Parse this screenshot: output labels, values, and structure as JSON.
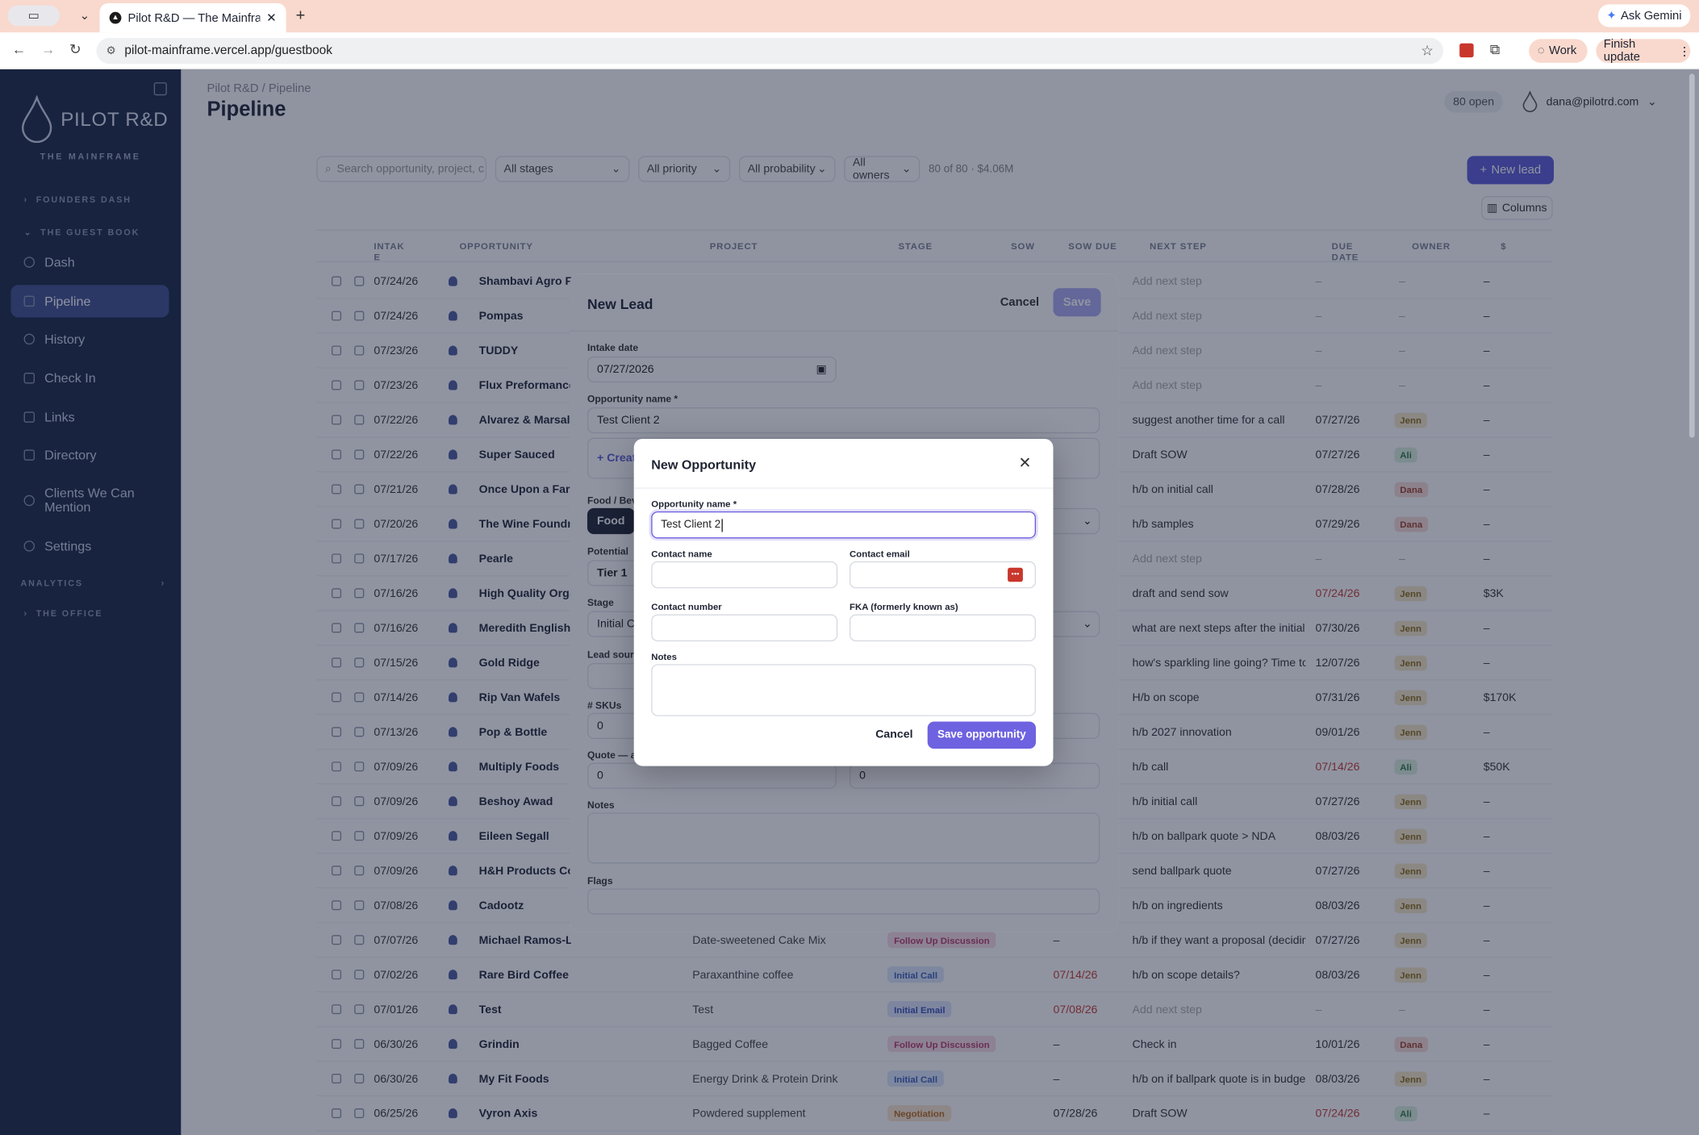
{
  "browser": {
    "tab_title": "Pilot R&D — The Mainframe",
    "url": "pilot-mainframe.vercel.app/guestbook",
    "ask_gemini": "Ask Gemini",
    "profile": "Work",
    "finish_update": "Finish update"
  },
  "sidebar": {
    "logo": "PILOT R&D",
    "tagline": "THE MAINFRAME",
    "founders_dash": "FOUNDERS DASH",
    "guest_book": "THE GUEST BOOK",
    "items": [
      {
        "label": "Dash"
      },
      {
        "label": "Pipeline"
      },
      {
        "label": "History"
      },
      {
        "label": "Check In"
      },
      {
        "label": "Links"
      },
      {
        "label": "Directory"
      },
      {
        "label": "Clients We Can Mention"
      },
      {
        "label": "Settings"
      }
    ],
    "analytics": "ANALYTICS",
    "office": "THE OFFICE"
  },
  "header": {
    "breadcrumb": "Pilot R&D / Pipeline",
    "title": "Pipeline",
    "open_count": "80 open",
    "user": "dana@pilotrd.com"
  },
  "filters": {
    "search_placeholder": "Search opportunity, project, c",
    "stages": "All stages",
    "priority": "All priority",
    "probability": "All probability",
    "owners": "All owners",
    "summary": "80 of 80 · $4.06M",
    "new_lead": "New lead",
    "columns": "Columns"
  },
  "table": {
    "headers": {
      "intake": "INTAK E",
      "opportunity": "OPPORTUNITY",
      "project": "PROJECT",
      "stage": "STAGE",
      "sow": "SOW",
      "sow_due": "SOW DUE",
      "next_step": "NEXT STEP",
      "due_date": "DUE DATE",
      "owner": "OWNER",
      "value": "$"
    },
    "rows": [
      {
        "date": "07/24/26",
        "name": "Shambavi Agro Fa",
        "project": "",
        "stage": "",
        "sow_due": "",
        "next": "Add next step",
        "due": "–",
        "owner": "",
        "val": "–"
      },
      {
        "date": "07/24/26",
        "name": "Pompas",
        "project": "",
        "stage": "",
        "sow_due": "",
        "next": "Add next step",
        "due": "–",
        "owner": "",
        "val": "–"
      },
      {
        "date": "07/23/26",
        "name": "TUDDY",
        "project": "",
        "stage": "",
        "sow_due": "",
        "next": "Add next step",
        "due": "–",
        "owner": "",
        "val": "–"
      },
      {
        "date": "07/23/26",
        "name": "Flux Preformance",
        "project": "",
        "stage": "",
        "sow_due": "",
        "next": "Add next step",
        "due": "–",
        "owner": "",
        "val": "–"
      },
      {
        "date": "07/22/26",
        "name": "Alvarez & Marsal",
        "project": "",
        "stage": "",
        "sow_due": "",
        "next": "suggest another time for a call",
        "due": "07/27/26",
        "owner": "Jenn",
        "val": "–"
      },
      {
        "date": "07/22/26",
        "name": "Super Sauced",
        "project": "",
        "stage": "",
        "sow_due": "",
        "next": "Draft SOW",
        "due": "07/27/26",
        "owner": "Ali",
        "val": "–"
      },
      {
        "date": "07/21/26",
        "name": "Once Upon a Farm",
        "project": "",
        "stage": "",
        "sow_due": "",
        "next": "h/b on initial call",
        "due": "07/28/26",
        "owner": "Dana",
        "val": "–"
      },
      {
        "date": "07/20/26",
        "name": "The Wine Foundry",
        "project": "",
        "stage": "",
        "sow_due": "",
        "next": "h/b samples",
        "due": "07/29/26",
        "owner": "Dana",
        "val": "–"
      },
      {
        "date": "07/17/26",
        "name": "Pearle",
        "project": "",
        "stage": "",
        "sow_due": "",
        "next": "Add next step",
        "due": "–",
        "owner": "",
        "val": "–"
      },
      {
        "date": "07/16/26",
        "name": "High Quality Orga",
        "project": "",
        "stage": "",
        "sow_due": "",
        "next": "draft and send sow",
        "due": "07/24/26",
        "owner": "Jenn",
        "val": "$3K"
      },
      {
        "date": "07/16/26",
        "name": "Meredith English",
        "project": "",
        "stage": "",
        "sow_due": "",
        "next": "what are next steps after the initial c",
        "due": "07/30/26",
        "owner": "Jenn",
        "val": "–"
      },
      {
        "date": "07/15/26",
        "name": "Gold Ridge",
        "project": "",
        "stage": "",
        "sow_due": "",
        "next": "how's sparkling line going? Time to g",
        "due": "12/07/26",
        "owner": "Jenn",
        "val": "–"
      },
      {
        "date": "07/14/26",
        "name": "Rip Van Wafels",
        "project": "",
        "stage": "",
        "sow_due": "",
        "next": "H/b on scope",
        "due": "07/31/26",
        "owner": "Jenn",
        "val": "$170K"
      },
      {
        "date": "07/13/26",
        "name": "Pop & Bottle",
        "project": "",
        "stage": "",
        "sow_due": "",
        "next": "h/b 2027 innovation",
        "due": "09/01/26",
        "owner": "Jenn",
        "val": "–"
      },
      {
        "date": "07/09/26",
        "name": "Multiply Foods",
        "project": "",
        "stage": "",
        "sow_due": "",
        "next": "h/b call",
        "due": "07/14/26",
        "owner": "Ali",
        "val": "$50K"
      },
      {
        "date": "07/09/26",
        "name": "Beshoy Awad",
        "project": "",
        "stage": "",
        "sow_due": "",
        "next": "h/b initial call",
        "due": "07/27/26",
        "owner": "Jenn",
        "val": "–"
      },
      {
        "date": "07/09/26",
        "name": "Eileen Segall",
        "project": "",
        "stage": "",
        "sow_due": "",
        "next": "h/b on ballpark quote > NDA",
        "due": "08/03/26",
        "owner": "Jenn",
        "val": "–"
      },
      {
        "date": "07/09/26",
        "name": "H&H Products Co",
        "project": "",
        "stage": "",
        "sow_due": "",
        "next": "send ballpark quote",
        "due": "07/27/26",
        "owner": "Jenn",
        "val": "–"
      },
      {
        "date": "07/08/26",
        "name": "Cadootz",
        "project": "",
        "stage": "",
        "sow_due": "",
        "next": "h/b on ingredients",
        "due": "08/03/26",
        "owner": "Jenn",
        "val": "–"
      },
      {
        "date": "07/07/26",
        "name": "Michael Ramos-Lynch",
        "project": "Date-sweetened Cake Mix",
        "stage": "Follow Up Discussion",
        "sow_due": "–",
        "next": "h/b if they want a proposal (deciding",
        "due": "07/27/26",
        "owner": "Jenn",
        "val": "–"
      },
      {
        "date": "07/02/26",
        "name": "Rare Bird Coffee",
        "project": "Paraxanthine coffee",
        "stage": "Initial Call",
        "sow_due": "07/14/26",
        "next": "h/b on scope details?",
        "due": "08/03/26",
        "owner": "Jenn",
        "val": "–"
      },
      {
        "date": "07/01/26",
        "name": "Test",
        "project": "Test",
        "stage": "Initial Email",
        "sow_due": "07/08/26",
        "next": "Add next step",
        "due": "–",
        "owner": "",
        "val": "–"
      },
      {
        "date": "06/30/26",
        "name": "Grindin",
        "project": "Bagged Coffee",
        "stage": "Follow Up Discussion",
        "sow_due": "–",
        "next": "Check in",
        "due": "10/01/26",
        "owner": "Dana",
        "val": "–"
      },
      {
        "date": "06/30/26",
        "name": "My Fit Foods",
        "project": "Energy Drink & Protein Drink",
        "stage": "Initial Call",
        "sow_due": "–",
        "next": "h/b on if ballpark quote is in budget a",
        "due": "08/03/26",
        "owner": "Jenn",
        "val": "–"
      },
      {
        "date": "06/25/26",
        "name": "Vyron Axis",
        "project": "Powdered supplement",
        "stage": "Negotiation",
        "sow_due": "07/28/26",
        "next": "Draft SOW",
        "due": "07/24/26",
        "owner": "Ali",
        "val": "–"
      }
    ]
  },
  "lead_modal": {
    "title": "New Lead",
    "cancel": "Cancel",
    "save": "Save",
    "intake_label": "Intake date",
    "intake_value": "07/27/2026",
    "opp_label": "Opportunity name *",
    "opp_value": "Test Client 2",
    "create": "+ Create",
    "food_label": "Food / Bev",
    "food_value": "Food",
    "potential_label": "Potential",
    "potential_value": "Tier 1",
    "stage_label": "Stage",
    "stage_value": "Initial C",
    "lead_source_label": "Lead sourc",
    "skus_label": "# SKUs",
    "skus_value": "0",
    "quote_label": "Quote — ac",
    "quote_value": "0",
    "quote_value2": "0",
    "notes_label": "Notes",
    "flags_label": "Flags"
  },
  "opp_modal": {
    "title": "New Opportunity",
    "name_label": "Opportunity name *",
    "name_value": "Test Client 2",
    "contact_name_label": "Contact name",
    "contact_email_label": "Contact email",
    "contact_number_label": "Contact number",
    "fka_label": "FKA (formerly known as)",
    "notes_label": "Notes",
    "cancel": "Cancel",
    "save": "Save opportunity"
  },
  "colors": {
    "sidebar": "#1a2744",
    "accent": "#6e62e0",
    "tabbar": "#f9d9cd"
  }
}
